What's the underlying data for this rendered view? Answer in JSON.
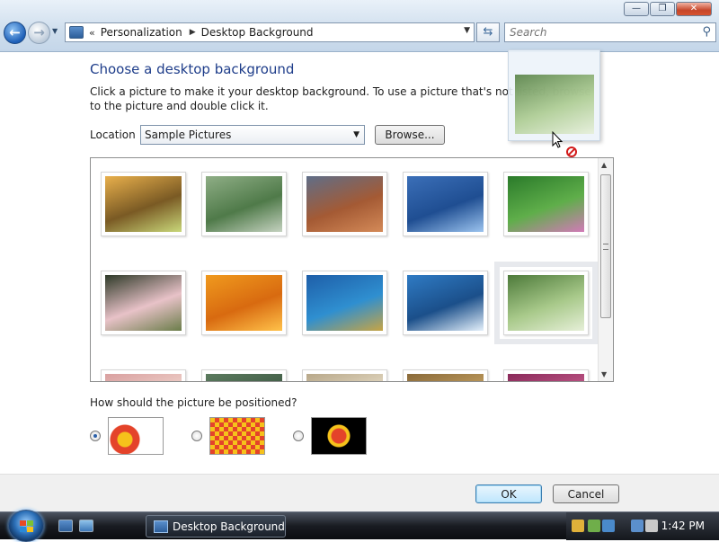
{
  "window": {
    "controls": {
      "minimize": "—",
      "maximize": "❐",
      "close": "✕"
    }
  },
  "address_bar": {
    "back_glyph": "←",
    "forward_glyph": "→",
    "chevron": "«",
    "breadcrumbs": [
      "Personalization",
      "Desktop Background"
    ]
  },
  "search": {
    "placeholder": "Search"
  },
  "main": {
    "title": "Choose a desktop background",
    "instructions": "Click a picture to make it your desktop background. To use a picture that's not listed, browse to the picture and double click it.",
    "location_label": "Location",
    "location_value": "Sample Pictures",
    "browse_label": "Browse...",
    "position_question": "How should the picture be positioned?",
    "selected_position_index": 0,
    "thumbnails": [
      {
        "name": "autumn",
        "colors": [
          "#e9b04c",
          "#7a5a24",
          "#c9d87a"
        ]
      },
      {
        "name": "creek",
        "colors": [
          "#8fae86",
          "#4f7a49",
          "#c5d2c0"
        ]
      },
      {
        "name": "desert",
        "colors": [
          "#5f6e88",
          "#a45a34",
          "#d48a58"
        ]
      },
      {
        "name": "dock",
        "colors": [
          "#3b6fb8",
          "#1f4e92",
          "#9cc4ef"
        ]
      },
      {
        "name": "forest-flowers",
        "colors": [
          "#2a7a2a",
          "#5fae4a",
          "#d27ab8"
        ]
      },
      {
        "name": "frangipani",
        "colors": [
          "#2e3a28",
          "#e8c2c8",
          "#6b7d4a"
        ]
      },
      {
        "name": "garden",
        "colors": [
          "#f09a1e",
          "#d86a10",
          "#ffc24a"
        ]
      },
      {
        "name": "green-sea-turtle",
        "colors": [
          "#1e5ea8",
          "#2f8fd0",
          "#c7a444"
        ]
      },
      {
        "name": "humpback-whale",
        "colors": [
          "#2f7bc4",
          "#1b4f8a",
          "#e4f0fb"
        ]
      },
      {
        "name": "forest",
        "colors": [
          "#4d7a3a",
          "#a8c98a",
          "#e6efd8"
        ]
      },
      {
        "name": "row3-a",
        "colors": [
          "#d9a0a0",
          "#f0d4cc",
          "#ffffff"
        ]
      },
      {
        "name": "row3-b",
        "colors": [
          "#5b7a5e",
          "#3e5a44",
          "#8aa08a"
        ]
      },
      {
        "name": "row3-c",
        "colors": [
          "#b8a88a",
          "#e6dcc6",
          "#8a7a5a"
        ]
      },
      {
        "name": "row3-d",
        "colors": [
          "#8a6a3a",
          "#c4a060",
          "#6a5a2a"
        ]
      },
      {
        "name": "row3-e",
        "colors": [
          "#8a2a5a",
          "#c45a8a",
          "#4a1a3a"
        ]
      }
    ],
    "position_options": [
      {
        "name": "fit-to-screen",
        "colors": [
          "#e4432a",
          "#f6c21b",
          "#ffffff"
        ]
      },
      {
        "name": "tile",
        "colors": [
          "#e4432a",
          "#f6c21b",
          "#8a3a10"
        ]
      },
      {
        "name": "center",
        "colors": [
          "#000000",
          "#e4432a",
          "#f6c21b"
        ]
      }
    ]
  },
  "drag": {
    "thumbnail_colors": [
      "#4d7a3a",
      "#a8c98a",
      "#e6efd8"
    ]
  },
  "footer": {
    "ok_label": "OK",
    "cancel_label": "Cancel"
  },
  "taskbar": {
    "active_window": "Desktop Background",
    "clock": "1:42 PM"
  },
  "colors": {
    "accent": "#1e3d8a",
    "selection": "#e7e9ed"
  }
}
